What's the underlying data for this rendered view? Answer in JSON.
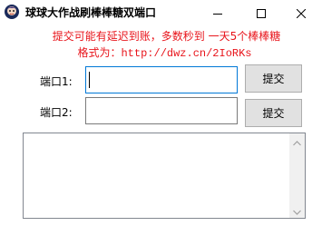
{
  "window": {
    "title": "球球大作战刷棒棒糖双端口",
    "app_icon": "game-character-icon",
    "controls": [
      "minimize-icon",
      "maximize-icon",
      "close-icon"
    ]
  },
  "notice": {
    "line1": "提交可能有延迟到账，多数秒到 一天5个棒棒糖",
    "line2_prefix": "格式为：",
    "line2_url": "http://dwz.cn/2IoRKs"
  },
  "ports": [
    {
      "label": "端口1:",
      "value": "",
      "placeholder": "",
      "button": "提交"
    },
    {
      "label": "端口2:",
      "value": "",
      "placeholder": "",
      "button": "提交"
    }
  ],
  "log": {
    "text": ""
  },
  "colors": {
    "notice": "#e8141b",
    "focus_border": "#0078d7",
    "button_bg": "#e1e1e1"
  }
}
